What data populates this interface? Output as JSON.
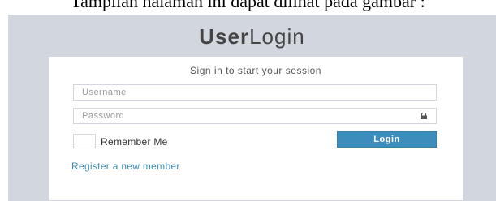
{
  "caption": "Tampilan halaman ini dapat dilihat pada gambar :",
  "logo": {
    "bold": "User",
    "light": "Login"
  },
  "login_box": {
    "message": "Sign in to start your session",
    "username_placeholder": "Username",
    "password_placeholder": "Password",
    "remember_label": "Remember Me",
    "login_button": "Login",
    "register_link": "Register a new member"
  },
  "icons": {
    "password_field": "lock-icon"
  },
  "colors": {
    "background": "#d2d6de",
    "button": "#3c8dbc",
    "link": "#3c8dbc"
  }
}
